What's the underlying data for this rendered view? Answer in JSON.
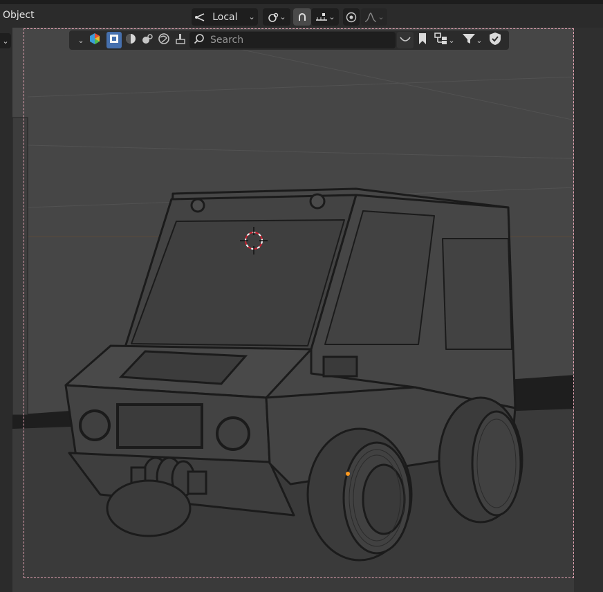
{
  "header": {
    "mode_label": "Object",
    "transform_orientation": "Local"
  },
  "overlay_toolbar": {
    "search_placeholder": "Search"
  },
  "icons": {
    "mode_dropdown": "chevron-down-icon",
    "orientation": "transform-orientation-icon",
    "pivot": "pivot-point-icon",
    "snap": "snap-magnet-icon",
    "snap_target": "snap-increment-icon",
    "proportional": "proportional-editing-icon",
    "falloff": "falloff-curve-icon",
    "color_picker": "color-wheel-icon",
    "shading_solid": "solid-shading-icon",
    "shading_material": "material-shading-icon",
    "shading_rendered": "render-shading-icon",
    "shading_world": "world-icon",
    "filter": "filter-icon",
    "bookmark": "bookmark-icon",
    "hierarchy": "hierarchy-icon",
    "shield": "shield-icon",
    "cursor": "3d-cursor-icon"
  },
  "colors": {
    "accent": "#4772b3",
    "header_bg": "#2b2b2b",
    "viewport_bg": "#464646",
    "camera_frame": "#e0a0b0"
  }
}
